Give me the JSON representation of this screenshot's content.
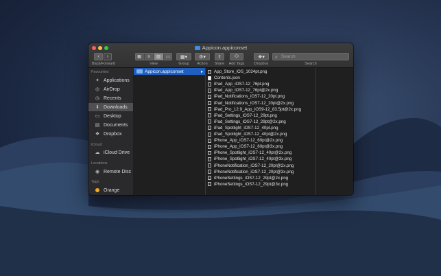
{
  "window": {
    "title": "Appicon.appiconset"
  },
  "toolbar": {
    "back_forward_label": "Back/Forward",
    "view_label": "View",
    "group_label": "Group",
    "action_label": "Action",
    "share_label": "Share",
    "add_tags_label": "Add Tags",
    "dropbox_label": "Dropbox",
    "search_label": "Search",
    "search_placeholder": "Search"
  },
  "sidebar": {
    "favourites_header": "Favourites",
    "icloud_header": "iCloud",
    "locations_header": "Locations",
    "tags_header": "Tags",
    "favourites": [
      {
        "label": "Applications",
        "icon": "applications-icon"
      },
      {
        "label": "AirDrop",
        "icon": "airdrop-icon"
      },
      {
        "label": "Recents",
        "icon": "clock-icon"
      },
      {
        "label": "Downloads",
        "icon": "downloads-icon"
      },
      {
        "label": "Desktop",
        "icon": "desktop-icon"
      },
      {
        "label": "Documents",
        "icon": "document-icon"
      },
      {
        "label": "Dropbox",
        "icon": "dropbox-icon"
      }
    ],
    "icloud": [
      {
        "label": "iCloud Drive",
        "icon": "cloud-icon"
      }
    ],
    "locations": [
      {
        "label": "Remote Disc",
        "icon": "disc-icon"
      }
    ],
    "tags": [
      {
        "label": "Orange",
        "color": "#f5a623"
      }
    ],
    "selected": "Downloads"
  },
  "columns": {
    "col1_item": "Appicon.appiconset",
    "files": [
      "App_Store_iOS_1024pt.png",
      "Contents.json",
      "iPad_App_iOS7-12_76pt.png",
      "iPad_App_iOS7-12_76pt@2x.png",
      "iPad_Notifications_iOS7-12_20pt.png",
      "iPad_Notifications_iOS7-12_20pt@2x.png",
      "iPad_Pro_12.9_App_iOS9-12_83.5pt@2x.png",
      "iPad_Settings_iOS7-12_29pt.png",
      "iPad_Settings_iOS7-12_29pt@2x.png",
      "iPad_Spotlight_iOS7-12_40pt.png",
      "iPad_Spotlight_iOS7-12_40pt@2x.png",
      "iPhone_App_iOS7-12_60pt@2x.png",
      "iPhone_App_iOS7-12_60pt@3x.png",
      "iPhone_Spotlight_iOS7-12_40pt@2x.png",
      "iPhone_Spotlight_iOS7-12_40pt@3x.png",
      "iPhoneNotification_iOS7-12_20pt@2x.png",
      "iPhoneNotification_iOS7-12_20pt@3x.png",
      "iPhoneSettings_iOS7-12_29pt@2x.png",
      "iPhoneSettings_iOS7-12_29pt@3x.png"
    ]
  },
  "colors": {
    "selection": "#1f5fbf",
    "window_bg": "#1e1e1e",
    "sidebar_bg": "#2a2a2c"
  }
}
